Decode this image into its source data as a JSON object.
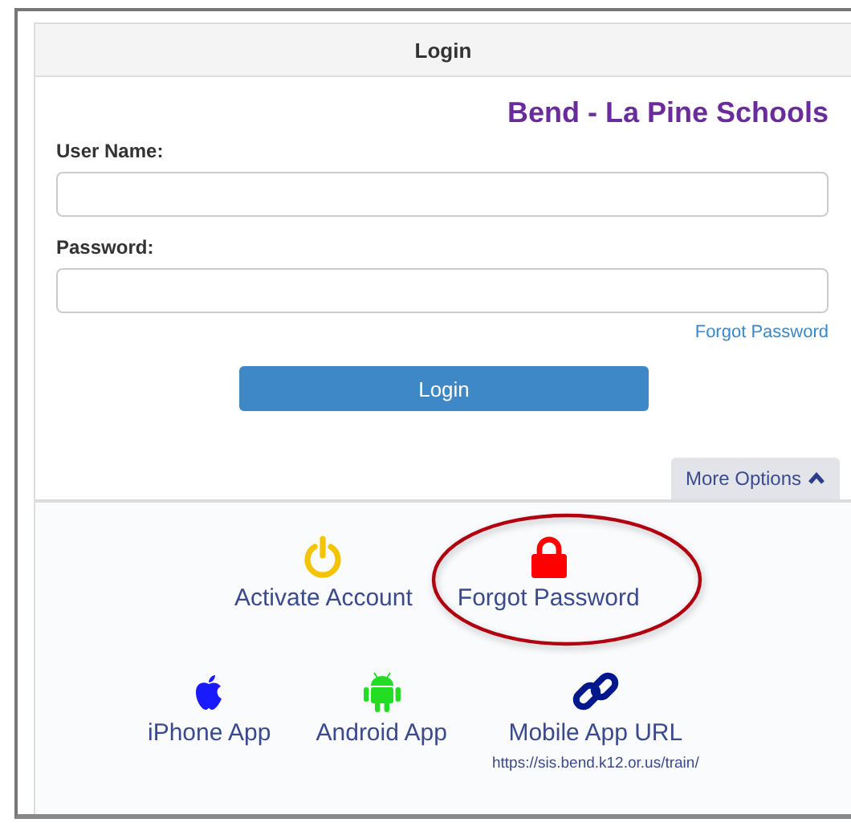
{
  "header": {
    "title": "Login"
  },
  "school_name": "Bend - La Pine Schools",
  "fields": [
    {
      "label": "User Name:"
    },
    {
      "label": "Password:"
    }
  ],
  "forgot_password_link": "Forgot Password",
  "login_button": "Login",
  "more_options": {
    "label": "More Options",
    "expanded": true
  },
  "options": {
    "activate_account": "Activate Account",
    "forgot_password": "Forgot Password",
    "iphone_app": "iPhone App",
    "android_app": "Android App",
    "mobile_app_url": {
      "label": "Mobile App URL",
      "url": "https://sis.bend.k12.or.us/train/"
    }
  },
  "annotation_ellipse": true
}
